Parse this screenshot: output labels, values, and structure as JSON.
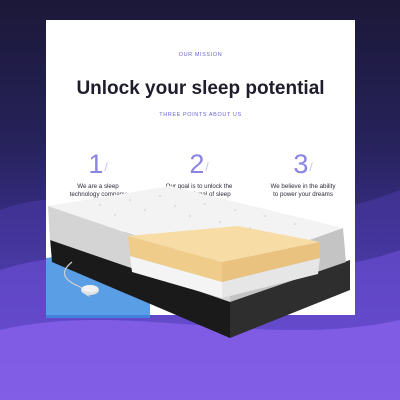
{
  "mission_label": "OUR MISSION",
  "headline": "Unlock your sleep potential",
  "points_label": "THREE POINTS ABOUT US",
  "points": [
    {
      "number": "1",
      "text_line1": "We are a sleep",
      "text_line2": "technology company"
    },
    {
      "number": "2",
      "text_line1": "Our goal is to unlock the",
      "text_line2": "full potentional of sleep"
    },
    {
      "number": "3",
      "text_line1": "We believe in the ability",
      "text_line2": "to power your dreams"
    }
  ],
  "colors": {
    "accent": "#6b63d6",
    "number": "#8b84e0",
    "background_top": "#1b1838",
    "background_bottom": "#8b62ee"
  }
}
